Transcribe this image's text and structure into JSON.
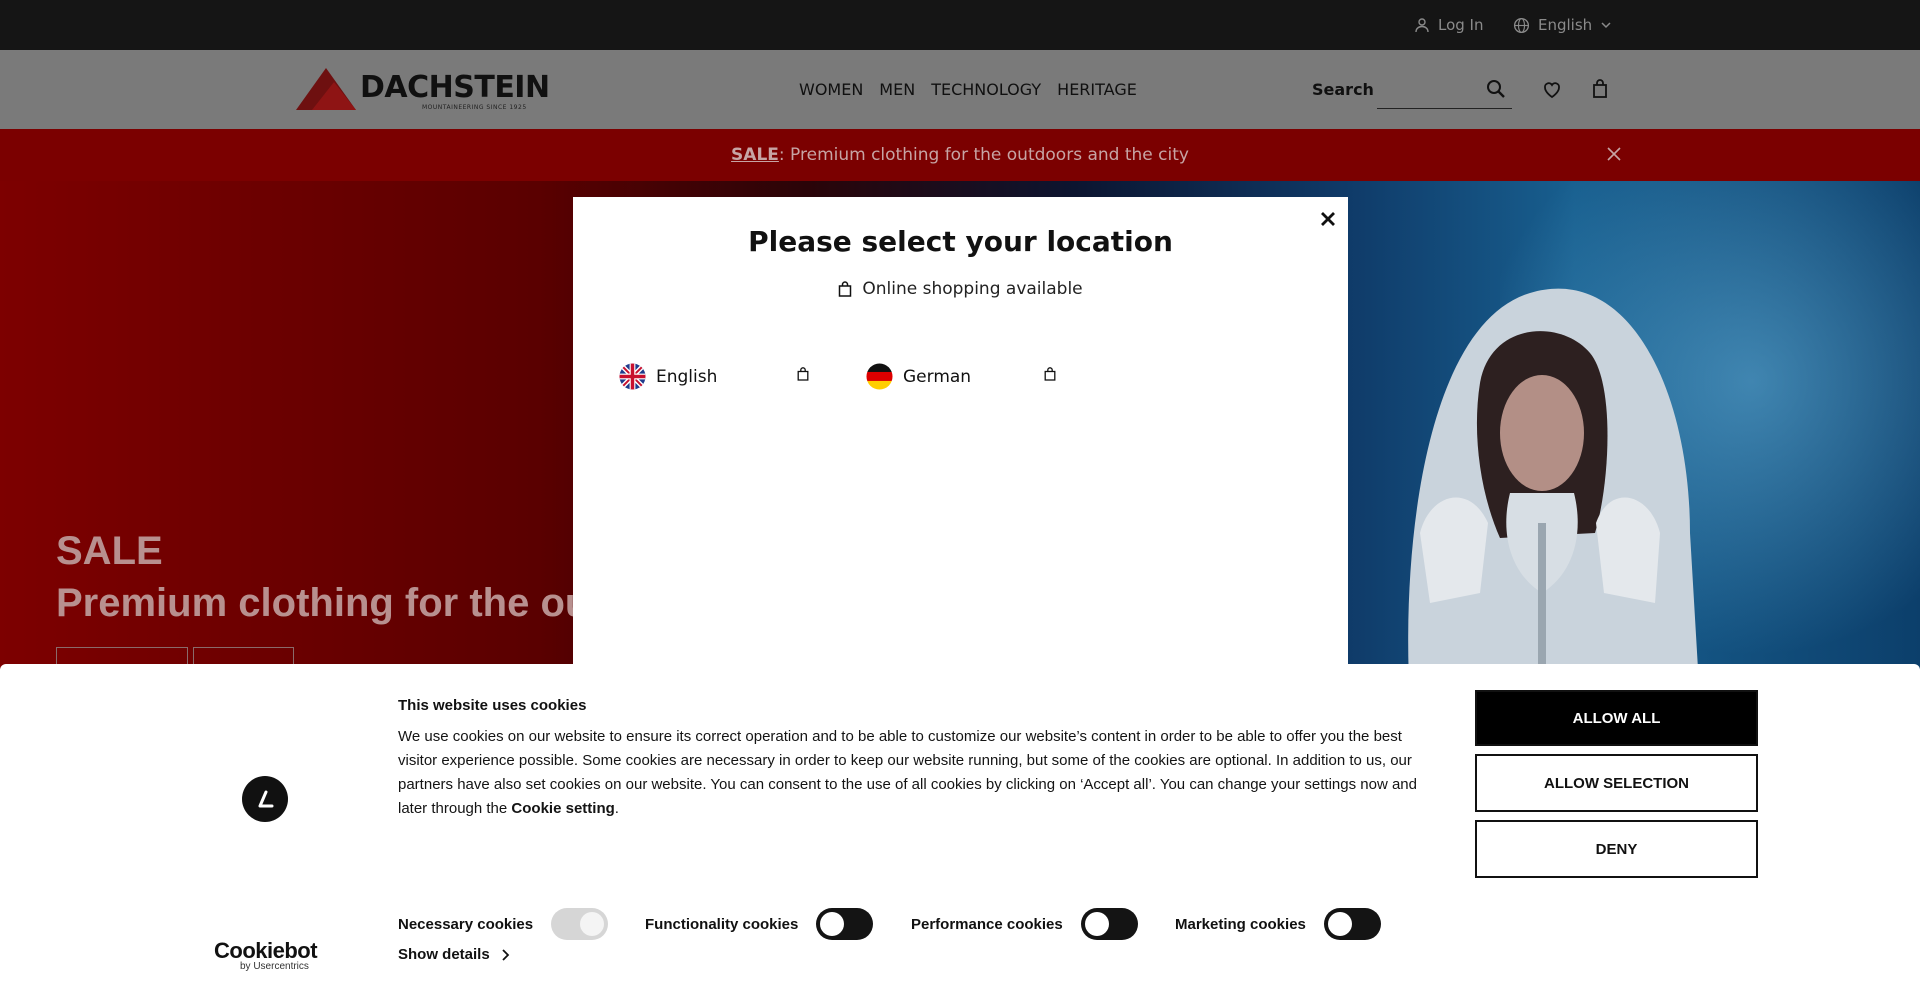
{
  "topbar": {
    "login_label": "Log In",
    "language_label": "English"
  },
  "header": {
    "logo_word": "DACHSTEIN",
    "logo_tagline": "MOUNTAINEERING SINCE 1925",
    "nav": [
      "WOMEN",
      "MEN",
      "TECHNOLOGY",
      "HERITAGE"
    ],
    "search_label": "Search"
  },
  "salebar": {
    "sale_label": "SALE",
    "message": ": Premium clothing for the outdoors and the city"
  },
  "hero": {
    "title": "SALE",
    "subtitle": "Premium clothing for the outdoors and the city"
  },
  "modal": {
    "title": "Please select your location",
    "subtitle": "Online shopping available",
    "locations": [
      {
        "label": "English"
      },
      {
        "label": "German"
      }
    ]
  },
  "cookie": {
    "heading": "This website uses cookies",
    "body": "We use cookies on our website to ensure its correct operation and to be able to customize our website’s content in order to be able to offer you the best visitor experience possible. Some cookies are necessary in order to keep our website running, but some of the cookies are optional. In addition to us, our partners have also set cookies on our website. You can consent to the use of all cookies by clicking on ‘Accept all’. You can change your settings now and later through the ",
    "link": "Cookie setting",
    "body_end": ".",
    "allow_all": "ALLOW ALL",
    "allow_selection": "ALLOW SELECTION",
    "deny": "DENY",
    "toggles": [
      {
        "label": "Necessary cookies",
        "checked": true
      },
      {
        "label": "Functionality cookies",
        "checked": false
      },
      {
        "label": "Performance cookies",
        "checked": false
      },
      {
        "label": "Marketing cookies",
        "checked": false
      }
    ],
    "show_details": "Show details",
    "brand": "Cookiebot",
    "brand_by": "by Usercentrics"
  },
  "colors": {
    "sale_red": "#8b0000",
    "brand_red": "#c4161c",
    "banner_black": "#000000"
  },
  "icons": [
    "user-icon",
    "globe-icon",
    "chevron-down-icon",
    "search-icon",
    "heart-icon",
    "bag-icon",
    "close-icon",
    "uk-flag-icon",
    "germany-flag-icon",
    "chevron-right-icon"
  ]
}
